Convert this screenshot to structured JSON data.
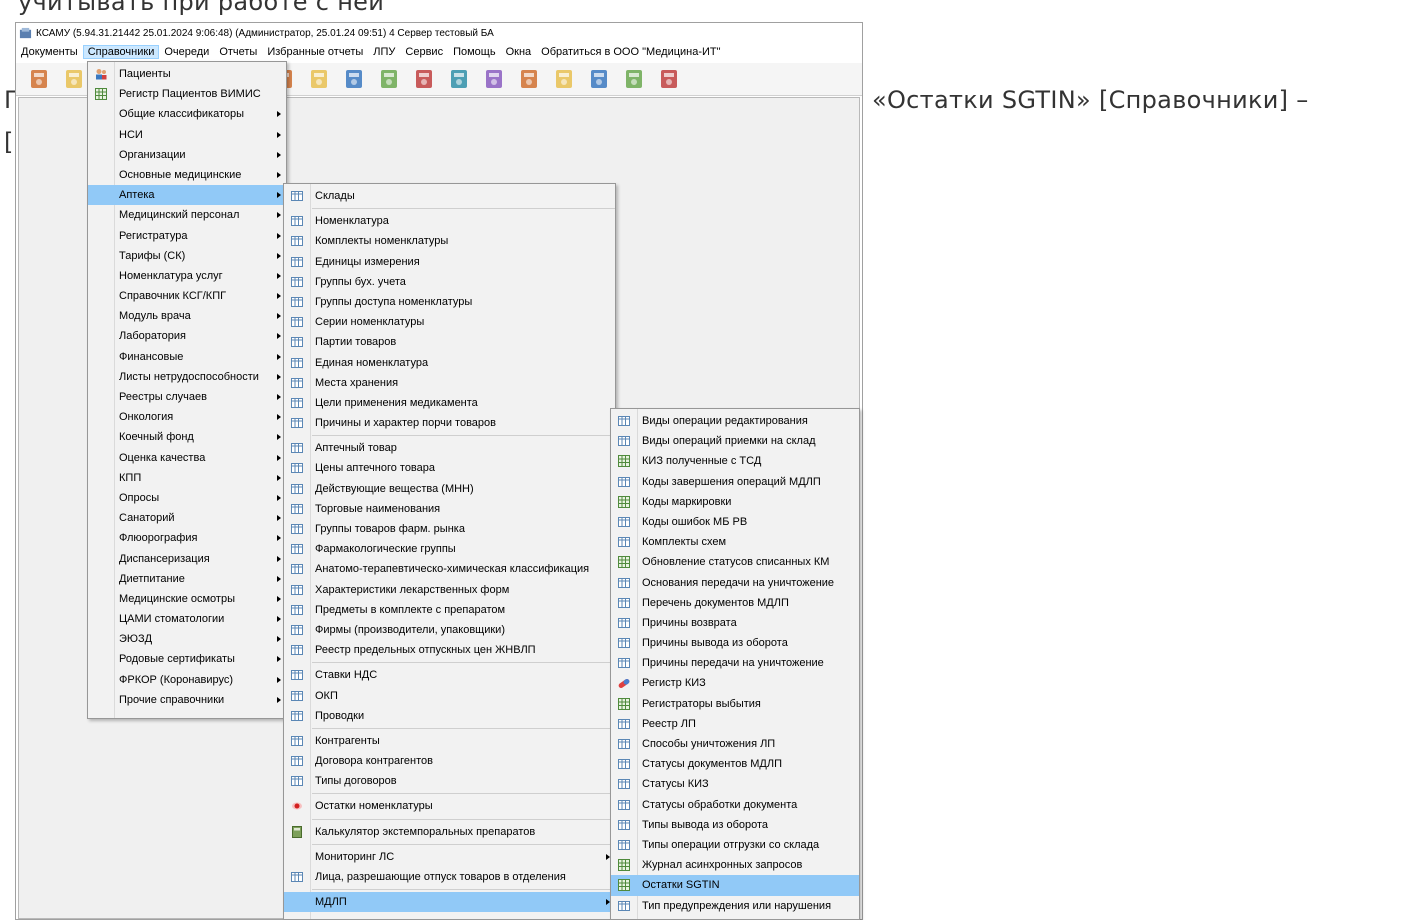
{
  "doc": {
    "top": "учитывать при работе с ней",
    "left1": "Г",
    "left2": "[",
    "right": "«Остатки SGTIN» [Справочники] –"
  },
  "window": {
    "title": "КСАМУ (5.94.31.21442 25.01.2024 9:06:48) (Администратор, 25.01.24 09:51) 4 Сервер тестовый БА"
  },
  "menubar": [
    "Документы",
    "Справочники",
    "Очереди",
    "Отчеты",
    "Избранные отчеты",
    "ЛПУ",
    "Сервис",
    "Помощь",
    "Окна",
    "Обратиться в ООО \"Медицина-ИТ\""
  ],
  "menu1": [
    {
      "label": "Пациенты",
      "icon": "patients-icon",
      "sub": false
    },
    {
      "label": "Регистр Пациентов ВИМИС",
      "icon": "grid-icon",
      "sub": false
    },
    {
      "label": "Общие классификаторы",
      "sub": true
    },
    {
      "label": "НСИ",
      "sub": true
    },
    {
      "label": "Организации",
      "sub": true
    },
    {
      "label": "Основные медицинские",
      "sub": true
    },
    {
      "label": "Аптека",
      "sub": true,
      "highlight": true
    },
    {
      "label": "Медицинский персонал",
      "sub": true
    },
    {
      "label": "Регистратура",
      "sub": true
    },
    {
      "label": "Тарифы (СК)",
      "sub": true
    },
    {
      "label": "Номенклатура услуг",
      "sub": true
    },
    {
      "label": "Справочник КСГ/КПГ",
      "sub": true
    },
    {
      "label": "Модуль врача",
      "sub": true
    },
    {
      "label": "Лаборатория",
      "sub": true
    },
    {
      "label": "Финансовые",
      "sub": true
    },
    {
      "label": "Листы нетрудоспособности",
      "sub": true
    },
    {
      "label": "Реестры случаев",
      "sub": true
    },
    {
      "label": "Онкология",
      "sub": true
    },
    {
      "label": "Коечный фонд",
      "sub": true
    },
    {
      "label": "Оценка качества",
      "sub": true
    },
    {
      "label": "КПП",
      "sub": true
    },
    {
      "label": "Опросы",
      "sub": true
    },
    {
      "label": "Санаторий",
      "sub": true
    },
    {
      "label": "Флюорография",
      "sub": true
    },
    {
      "label": "Диспансеризация",
      "sub": true
    },
    {
      "label": "Диетпитание",
      "sub": true
    },
    {
      "label": "Медицинские осмотры",
      "sub": true
    },
    {
      "label": "ЦАМИ стоматологии",
      "sub": true
    },
    {
      "label": "ЭЮЗД",
      "sub": true
    },
    {
      "label": "Родовые сертификаты",
      "sub": true
    },
    {
      "label": "ФРКОР (Коронавирус)",
      "sub": true
    },
    {
      "label": "Прочие справочники",
      "sub": true
    }
  ],
  "menu2": [
    {
      "label": "Склады",
      "icon": "table-icon"
    },
    {
      "sep": true
    },
    {
      "label": "Номенклатура",
      "icon": "table-icon"
    },
    {
      "label": "Комплекты номенклатуры",
      "icon": "table-icon"
    },
    {
      "label": "Единицы измерения",
      "icon": "table-icon"
    },
    {
      "label": "Группы бух. учета",
      "icon": "table-icon"
    },
    {
      "label": "Группы доступа номенклатуры",
      "icon": "table-icon"
    },
    {
      "label": "Серии номенклатуры",
      "icon": "table-icon"
    },
    {
      "label": "Партии товаров",
      "icon": "table-icon"
    },
    {
      "label": "Единая номенклатура",
      "icon": "table-icon"
    },
    {
      "label": "Места хранения",
      "icon": "table-icon"
    },
    {
      "label": "Цели применения медикамента",
      "icon": "table-icon"
    },
    {
      "label": "Причины и характер порчи товаров",
      "icon": "table-icon"
    },
    {
      "sep": true
    },
    {
      "label": "Аптечный товар",
      "icon": "table-icon"
    },
    {
      "label": "Цены аптечного товара",
      "icon": "table-icon"
    },
    {
      "label": "Действующие вещества (МНН)",
      "icon": "table-icon"
    },
    {
      "label": "Торговые наименования",
      "icon": "table-icon"
    },
    {
      "label": "Группы товаров фарм. рынка",
      "icon": "table-icon"
    },
    {
      "label": "Фармакологические группы",
      "icon": "table-icon"
    },
    {
      "label": "Анатомо-терапевтическо-химическая классификация",
      "icon": "table-icon"
    },
    {
      "label": "Характеристики лекарственных форм",
      "icon": "table-icon"
    },
    {
      "label": "Предметы в комплекте с препаратом",
      "icon": "table-icon"
    },
    {
      "label": "Фирмы (производители, упаковщики)",
      "icon": "table-icon"
    },
    {
      "label": "Реестр предельных отпускных цен ЖНВЛП",
      "icon": "table-icon"
    },
    {
      "sep": true
    },
    {
      "label": "Ставки НДС",
      "icon": "table-icon"
    },
    {
      "label": "ОКП",
      "icon": "table-icon"
    },
    {
      "label": "Проводки",
      "icon": "table-icon"
    },
    {
      "sep": true
    },
    {
      "label": "Контрагенты",
      "icon": "table-icon"
    },
    {
      "label": "Договора контрагентов",
      "icon": "table-icon"
    },
    {
      "label": "Типы договоров",
      "icon": "table-icon"
    },
    {
      "sep": true
    },
    {
      "label": "Остатки номенклатуры",
      "icon": "pill-red-icon"
    },
    {
      "sep": true
    },
    {
      "label": "Калькулятор экстемпоральных препаратов",
      "icon": "calculator-icon"
    },
    {
      "sep": true
    },
    {
      "label": "Мониторинг ЛС",
      "sub": true
    },
    {
      "label": "Лица, разрешающие отпуск товаров в отделения",
      "icon": "table-icon"
    },
    {
      "sep": true
    },
    {
      "label": "МДЛП",
      "sub": true,
      "highlight": true
    }
  ],
  "menu3": [
    {
      "label": "Виды операции редактирования",
      "icon": "table-icon"
    },
    {
      "label": "Виды операций приемки на склад",
      "icon": "table-icon"
    },
    {
      "label": "КИЗ полученные с ТСД",
      "icon": "green-grid-icon"
    },
    {
      "label": "Коды завершения операций МДЛП",
      "icon": "table-icon"
    },
    {
      "label": "Коды маркировки",
      "icon": "green-grid-icon"
    },
    {
      "label": "Коды ошибок МБ РВ",
      "icon": "table-icon"
    },
    {
      "label": "Комплекты схем",
      "icon": "table-icon"
    },
    {
      "label": "Обновление статусов списанных КМ",
      "icon": "green-grid-icon"
    },
    {
      "label": "Основания передачи на уничтожение",
      "icon": "table-icon"
    },
    {
      "label": "Перечень документов МДЛП",
      "icon": "table-icon"
    },
    {
      "label": "Причины возврата",
      "icon": "table-icon"
    },
    {
      "label": "Причины вывода из оборота",
      "icon": "table-icon"
    },
    {
      "label": "Причины передачи на уничтожение",
      "icon": "table-icon"
    },
    {
      "label": "Регистр КИЗ",
      "icon": "pill-icon"
    },
    {
      "label": "Регистраторы выбытия",
      "icon": "green-grid-icon"
    },
    {
      "label": "Реестр ЛП",
      "icon": "table-icon"
    },
    {
      "label": "Способы уничтожения ЛП",
      "icon": "table-icon"
    },
    {
      "label": "Статусы документов МДЛП",
      "icon": "table-icon"
    },
    {
      "label": "Статусы КИЗ",
      "icon": "table-icon"
    },
    {
      "label": "Статусы обработки документа",
      "icon": "table-icon"
    },
    {
      "label": "Типы вывода из оборота",
      "icon": "table-icon"
    },
    {
      "label": "Типы операции отгрузки со склада",
      "icon": "table-icon"
    },
    {
      "label": "Журнал асинхронных запросов",
      "icon": "green-grid-icon"
    },
    {
      "label": "Остатки SGTIN",
      "icon": "green-grid-icon",
      "highlight": true
    },
    {
      "label": "Тип предупреждения или нарушения",
      "icon": "table-icon"
    }
  ],
  "toolbar_icons": [
    "doctor-icon",
    "notes-icon",
    "book-icon",
    "calendar-icon",
    "folder-icon",
    "chart-icon",
    "gear-icon",
    "lab-icon",
    "medkit-icon",
    "books-icon",
    "flask-icon",
    "barcode-icon",
    "nurse-icon",
    "red-book-icon",
    "window-icon",
    "list-icon",
    "pdf-icon",
    "lock-icon",
    "chat-icon"
  ]
}
